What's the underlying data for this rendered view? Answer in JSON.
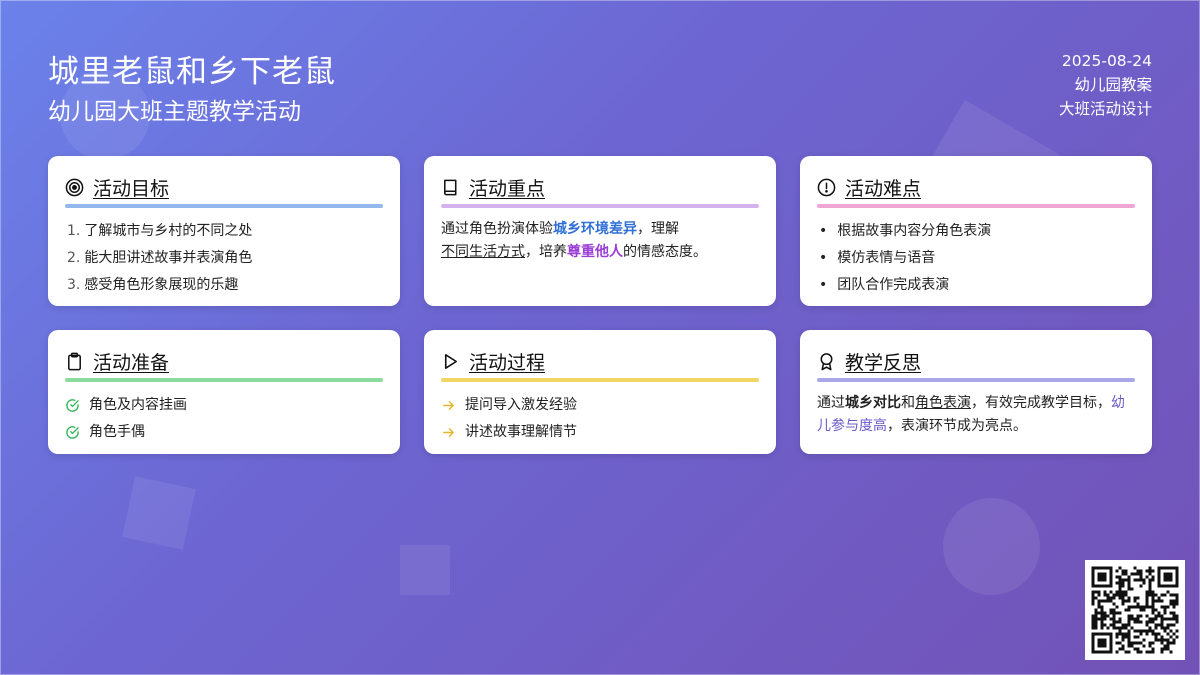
{
  "header": {
    "title": "城里老鼠和乡下老鼠",
    "subtitle": "幼儿园大班主题教学活动",
    "date": "2025-08-24",
    "type": "幼儿园教案",
    "design": "大班活动设计"
  },
  "cards": {
    "goal": {
      "title": "活动目标",
      "icon": "target-icon",
      "accent": "#93b8ee",
      "items": [
        "了解城市与乡村的不同之处",
        "能大胆讲述故事并表演角色",
        "感受角色形象展现的乐趣"
      ],
      "nums": [
        "1.",
        "2.",
        "3."
      ]
    },
    "focus": {
      "title": "活动重点",
      "icon": "book-icon",
      "accent": "#d3b2ee",
      "text": {
        "p1": "通过角色扮演体验",
        "h1": "城乡环境差异",
        "p2": "，理解",
        "u1": "不同生活方式",
        "p3": "，培养",
        "h2": "尊重他人",
        "p4": "的情感态度。"
      }
    },
    "difficulty": {
      "title": "活动难点",
      "icon": "alert-circle-icon",
      "accent": "#efa6d3",
      "items": [
        "根据故事内容分角色表演",
        "模仿表情与语音",
        "团队合作完成表演"
      ]
    },
    "prep": {
      "title": "活动准备",
      "icon": "clipboard-icon",
      "accent": "#8bdb9e",
      "items": [
        "角色及内容挂画",
        "角色手偶"
      ]
    },
    "process": {
      "title": "活动过程",
      "icon": "play-icon",
      "accent": "#f2d665",
      "items": [
        "提问导入激发经验",
        "讲述故事理解情节"
      ]
    },
    "reflection": {
      "title": "教学反思",
      "icon": "award-icon",
      "accent": "#a9a6ea",
      "text": {
        "p1": "通过",
        "b1": "城乡对比",
        "p2": "和",
        "u1": "角色表演",
        "p3": "，有效完成教学目标，",
        "h1": "幼儿参与度高",
        "p4": "，表演环节成为亮点。"
      }
    }
  },
  "colors": {
    "check": "#35b65a",
    "arrow": "#e6b72a"
  }
}
